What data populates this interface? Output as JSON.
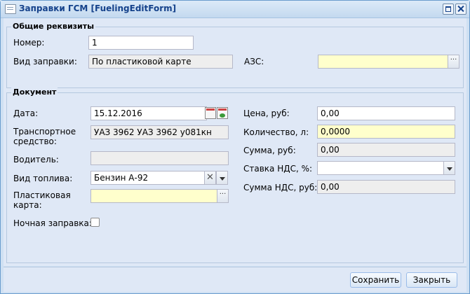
{
  "window": {
    "title": "Заправки ГСМ [FuelingEditForm]"
  },
  "general": {
    "legend": "Общие реквизиты",
    "number_label": "Номер:",
    "number_value": "1",
    "type_label": "Вид заправки:",
    "type_value": "По пластиковой карте",
    "azs_label": "АЗС:",
    "azs_value": ""
  },
  "document": {
    "legend": "Документ",
    "date_label": "Дата:",
    "date_value": "15.12.2016",
    "vehicle_label_1": "Транспортное",
    "vehicle_label_2": "средство:",
    "vehicle_value": "УАЗ 3962 УАЗ 3962 у081кн",
    "driver_label": "Водитель:",
    "driver_value": "",
    "fuel_label": "Вид топлива:",
    "fuel_value": "Бензин  А-92",
    "card_label_1": "Пластиковая",
    "card_label_2": "карта:",
    "card_value": "",
    "night_label": "Ночная заправка:",
    "night_checked": false,
    "price_label": "Цена, руб:",
    "price_value": "0,00",
    "qty_label": "Количество, л:",
    "qty_value": "0,0000",
    "sum_label": "Сумма, руб:",
    "sum_value": "0,00",
    "vat_rate_label": "Ставка НДС, %:",
    "vat_rate_value": "",
    "vat_sum_label": "Сумма НДС, руб:",
    "vat_sum_value": "0,00"
  },
  "footer": {
    "save_label": "Сохранить",
    "close_label": "Закрыть"
  },
  "colors": {
    "title_text": "#15428b",
    "required_bg": "#ffffcc",
    "readonly_bg": "#eeeeee",
    "panel_bg": "#dfe8f6"
  },
  "icons": [
    "form-icon",
    "maximize-icon",
    "close-icon",
    "ellipsis-icon",
    "calendar-icon",
    "calendar-refresh-icon",
    "clear-icon",
    "chevron-down-icon",
    "checkbox-icon"
  ]
}
